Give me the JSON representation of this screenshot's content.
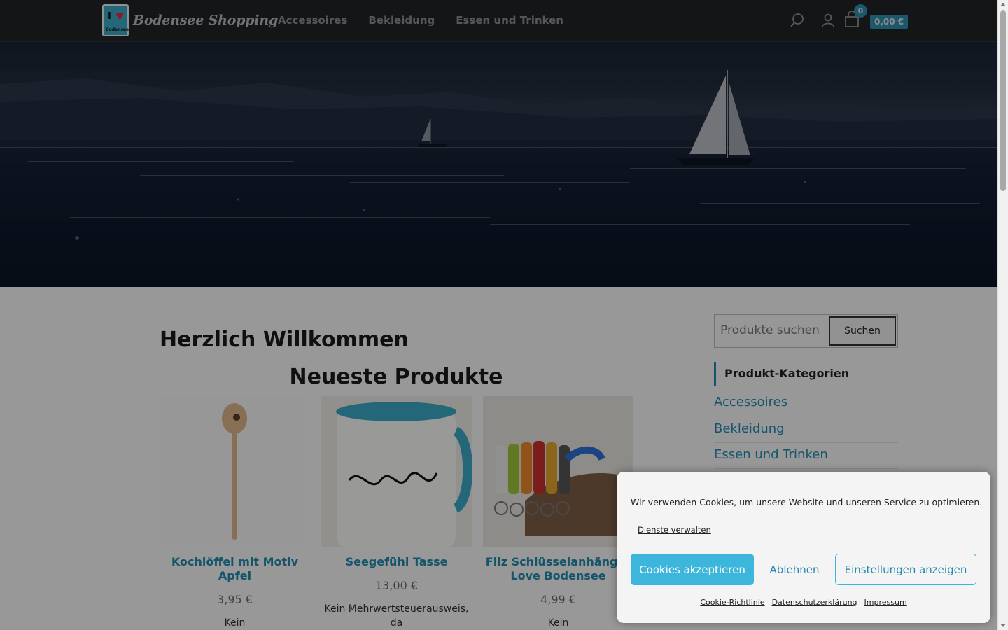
{
  "header": {
    "logo_text": "Bodensee Shopping",
    "logo_badge": "I",
    "logo_sub": "Bodensee",
    "nav": [
      "Accessoires",
      "Bekleidung",
      "Essen und Trinken"
    ],
    "cart_count": "0",
    "cart_total": "0,00 €"
  },
  "main": {
    "welcome": "Herzlich Willkommen",
    "section_title": "Neueste Produkte",
    "products": [
      {
        "name": "Kochlöffel mit Motiv Apfel",
        "price": "3,95 €",
        "note": "Kein"
      },
      {
        "name": "Seegefühl Tasse",
        "price": "13,00 €",
        "note": "Kein Mehrwertsteuerausweis, da"
      },
      {
        "name": "Filz Schlüsselanhänger Love Bodensee",
        "price": "4,99 €",
        "note": "Kein"
      }
    ]
  },
  "sidebar": {
    "search_placeholder": "Produkte suchen",
    "search_button": "Suchen",
    "categories_title": "Produkt-Kategorien",
    "categories": [
      "Accessoires",
      "Bekleidung",
      "Essen und Trinken"
    ]
  },
  "cookie": {
    "message": "Wir verwenden Cookies, um unsere Website und unseren Service zu optimieren.",
    "manage": "Dienste verwalten",
    "accept": "Cookies akzeptieren",
    "deny": "Ablehnen",
    "settings": "Einstellungen anzeigen",
    "links": [
      "Cookie-Richtlinie",
      "Datenschutzerklärung",
      "Impressum"
    ]
  },
  "colors": {
    "accent": "#2389ad",
    "accept_button": "#3db6dc",
    "header_bg": "#1f2324"
  }
}
